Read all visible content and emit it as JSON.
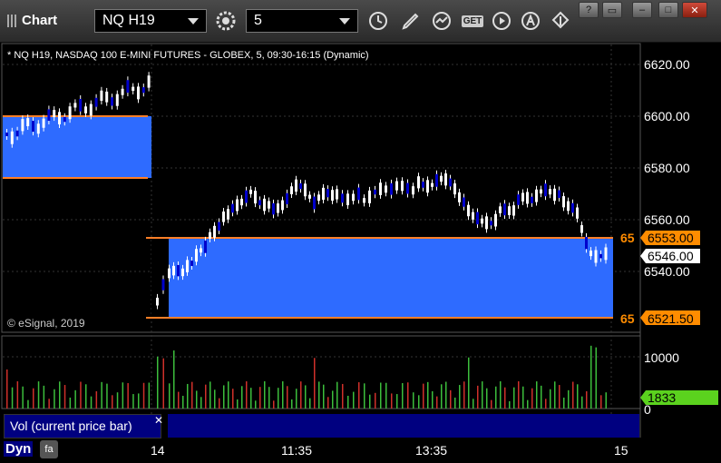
{
  "window": {
    "title": "Chart",
    "symbol": "NQ H19",
    "interval": "5",
    "get_label": "GET"
  },
  "chart": {
    "header": "* NQ H19, NASDAQ 100 E-MINI FUTURES - GLOBEX, 5, 09:30-16:15 (Dynamic)",
    "copyright": "© eSignal, 2019",
    "price_axis": [
      "6620.00",
      "6600.00",
      "6580.00",
      "6560.00",
      "6540.00"
    ],
    "range_lines": [
      "65",
      "65"
    ],
    "tags": {
      "upper": "6553.00",
      "current": "6546.00",
      "lower": "6521.50"
    },
    "colors": {
      "zone": "#2e6bff",
      "zone_line": "#ff7f27",
      "up": "#ffffff",
      "down": "#0000cc",
      "volume_up": "#3cbe3c",
      "volume_down": "#d0302a",
      "current_tag": "#ffffff",
      "edge_tag": "#ff8c00",
      "volume_tag": "#5bd21e"
    }
  },
  "volume": {
    "axis": [
      "10000",
      "0"
    ],
    "current": "1833",
    "study_label": "Vol (current price bar)"
  },
  "x_axis": [
    "14",
    "11:35",
    "13:35",
    "15"
  ],
  "footer": {
    "dyn": "Dyn"
  }
}
